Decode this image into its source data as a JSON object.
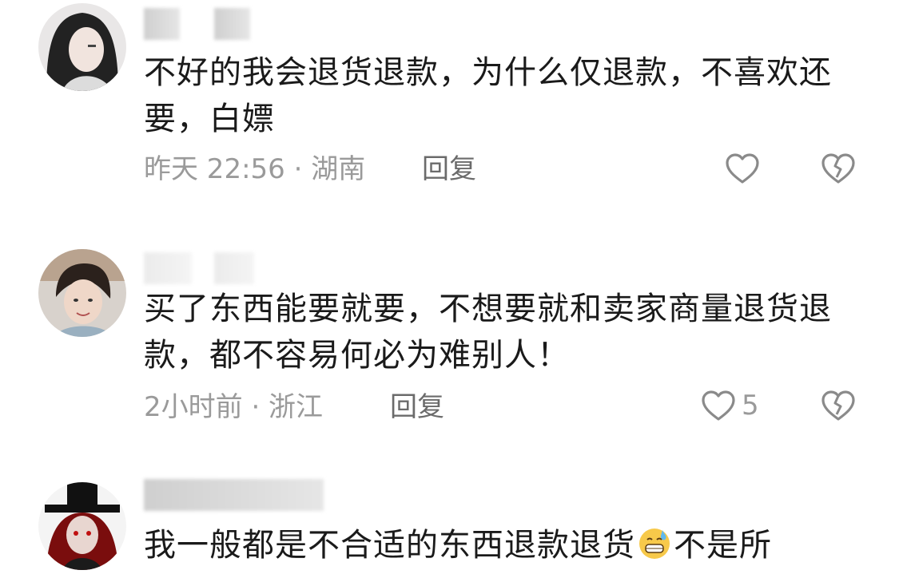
{
  "comments": [
    {
      "text": "不好的我会退货退款，为什么仅退款，不喜欢还要，白嫖",
      "time_location": "昨天 22:56 · 湖南",
      "reply_label": "回复",
      "like_icon": "heart-outline-icon",
      "dislike_icon": "broken-heart-icon",
      "like_count": ""
    },
    {
      "text": "买了东西能要就要，不想要就和卖家商量退货退款，都不容易何必为难别人！",
      "time_location": "2小时前 · 浙江",
      "reply_label": "回复",
      "like_icon": "heart-outline-icon",
      "dislike_icon": "broken-heart-icon",
      "like_count": "5"
    },
    {
      "text_before_emoji": "我一般都是不合适的东西退款退货",
      "emoji": "grinning-sweat-emoji",
      "text_after_emoji": "不是所"
    }
  ],
  "colors": {
    "text": "#1a1a1a",
    "meta": "#9a9a9a",
    "reply": "#6b6b6b",
    "icon": "#8a8a8a"
  }
}
